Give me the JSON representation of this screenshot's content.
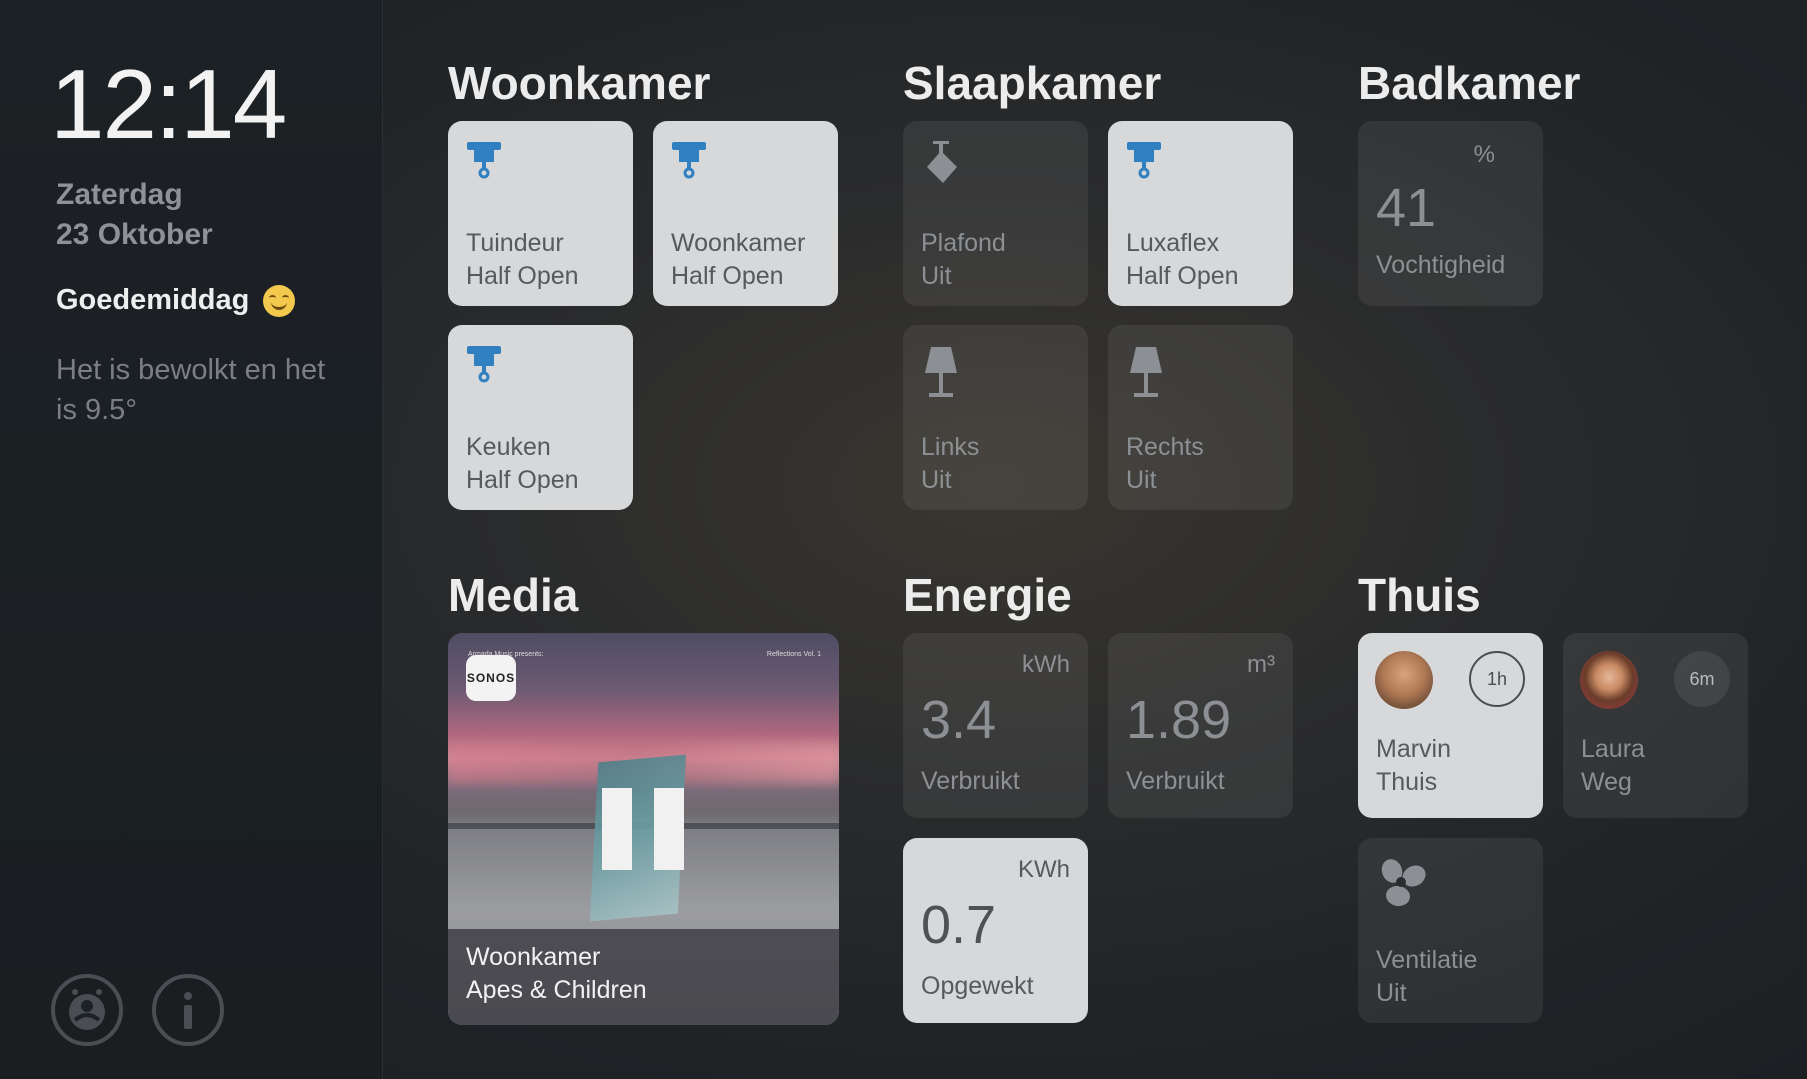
{
  "sidebar": {
    "time": "12:14",
    "day": "Zaterdag",
    "date": "23 Oktober",
    "greeting": "Goedemiddag",
    "weather": "Het is bewolkt en het is 9.5°"
  },
  "sections": {
    "woonkamer": "Woonkamer",
    "slaapkamer": "Slaapkamer",
    "badkamer": "Badkamer",
    "media": "Media",
    "energie": "Energie",
    "thuis": "Thuis"
  },
  "woonkamer": [
    {
      "name": "Tuindeur",
      "state": "Half Open"
    },
    {
      "name": "Woonkamer",
      "state": "Half Open"
    },
    {
      "name": "Keuken",
      "state": "Half Open"
    }
  ],
  "slaapkamer": [
    {
      "name": "Plafond",
      "state": "Uit"
    },
    {
      "name": "Luxaflex",
      "state": "Half Open"
    },
    {
      "name": "Links",
      "state": "Uit"
    },
    {
      "name": "Rechts",
      "state": "Uit"
    }
  ],
  "badkamer": {
    "unit": "%",
    "value": "41",
    "label": "Vochtigheid"
  },
  "media": {
    "brand": "SONOS",
    "album_top_left": "Armada Music presents:",
    "album_top_right": "Reflections Vol. 1",
    "room": "Woonkamer",
    "track": "Apes & Children"
  },
  "energie": [
    {
      "unit": "kWh",
      "value": "3.4",
      "label": "Verbruikt"
    },
    {
      "unit": "m³",
      "value": "1.89",
      "label": "Verbruikt"
    },
    {
      "unit": "KWh",
      "value": "0.7",
      "label": "Opgewekt"
    }
  ],
  "thuis": {
    "people": [
      {
        "name": "Marvin",
        "state": "Thuis",
        "time": "1h"
      },
      {
        "name": "Laura",
        "state": "Weg",
        "time": "6m"
      }
    ],
    "fan": {
      "name": "Ventilatie",
      "state": "Uit"
    }
  },
  "colors": {
    "accent_blue": "#2f7fc1",
    "tile_on": "#d7d8d9"
  }
}
